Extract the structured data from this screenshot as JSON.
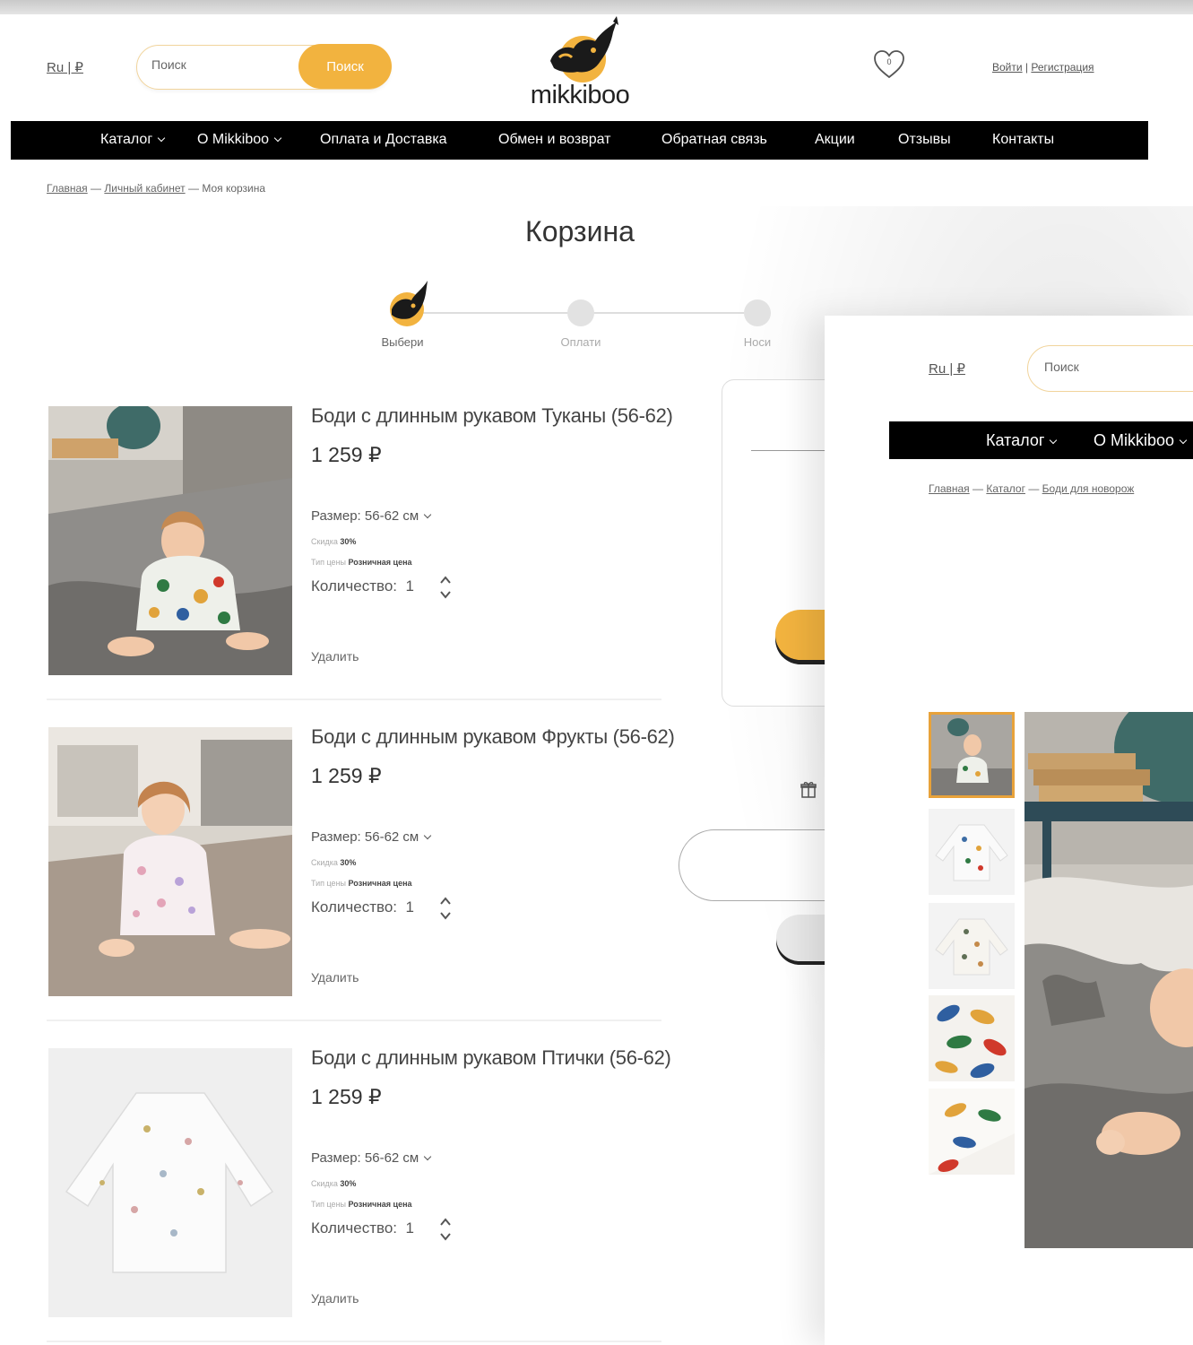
{
  "header": {
    "lang": "Ru | ₽",
    "search_placeholder": "Поиск",
    "search_button": "Поиск",
    "logo_text": "mikkiboo",
    "login": "Войти",
    "auth_sep": " | ",
    "register": "Регистрация"
  },
  "nav": {
    "catalog": "Каталог",
    "about": "О Mikkiboo",
    "payment": "Оплата и Доставка",
    "exchange": "Обмен и возврат",
    "feedback": "Обратная связь",
    "promo": "Акции",
    "reviews": "Отзывы",
    "contacts": "Контакты"
  },
  "breadcrumb": {
    "home": "Главная",
    "account": "Личный кабинет",
    "current": "Моя корзина",
    "sep": " — "
  },
  "page_title": "Корзина",
  "steps": [
    "Выбери",
    "Оплати",
    "Носи"
  ],
  "cart": {
    "items": [
      {
        "title": "Боди с длинным рукавом Туканы (56-62)",
        "price": "1 259 ₽",
        "size": "Размер: 56-62 см",
        "discount_label": "Скидка",
        "discount": "30%",
        "price_type_label": "Тип цены",
        "price_type": "Розничная цена",
        "qty_label": "Количество:",
        "qty": "1",
        "remove": "Удалить"
      },
      {
        "title": "Боди с длинным рукавом Фрукты (56-62)",
        "price": "1 259 ₽",
        "size": "Размер: 56-62 см",
        "discount_label": "Скидка",
        "discount": "30%",
        "price_type_label": "Тип цены",
        "price_type": "Розничная цена",
        "qty_label": "Количество:",
        "qty": "1",
        "remove": "Удалить"
      },
      {
        "title": "Боди с длинным рукавом Птички (56-62)",
        "price": "1 259 ₽",
        "size": "Размер: 56-62 см",
        "discount_label": "Скидка",
        "discount": "30%",
        "price_type_label": "Тип цены",
        "price_type": "Розничная цена",
        "qty_label": "Количество:",
        "qty": "1",
        "remove": "Удалить"
      }
    ]
  },
  "overlay": {
    "lang": "Ru | ₽",
    "search_placeholder": "Поиск",
    "nav_catalog": "Каталог",
    "nav_about": "О Mikkiboo",
    "crumb_home": "Главная",
    "crumb_catalog": "Каталог",
    "crumb_current": "Боди для новорож",
    "sep": " — "
  },
  "colors": {
    "accent": "#f2b33f",
    "nav_bg": "#000000",
    "text": "#333333"
  },
  "icons": [
    "heart-icon",
    "gift-icon",
    "chevron-down-icon",
    "stepper-icon",
    "dog-logo-icon"
  ]
}
